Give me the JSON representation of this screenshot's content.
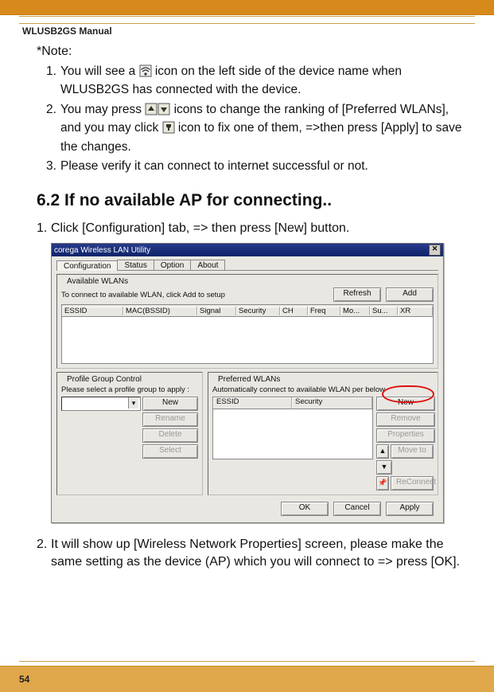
{
  "manual_title": "WLUSB2GS Manual",
  "note_label": "*Note:",
  "notes": {
    "item1": {
      "num": "1.",
      "pre": "You will see a ",
      "post": " icon on the left side of the device name when WLUSB2GS has connected  with the device."
    },
    "item2": {
      "num": "2.",
      "pre": "You may press  ",
      "mid1": "  icons to change the ranking of [Preferred WLANs], and you may click  ",
      "post": " icon to fix one of them, =>then press [Apply] to save the changes."
    },
    "item3": {
      "num": "3.",
      "text": "Please verify it can connect to internet successful or not."
    }
  },
  "section_heading": "6.2 If no available AP for connecting..",
  "step1": {
    "num": "1.",
    "text": "Click [Configuration] tab, => then press [New] button."
  },
  "step2": {
    "num": "2.",
    "text": "It will show up [Wireless Network Properties] screen, please make the same setting as the device (AP) which you will connect to => press [OK]."
  },
  "dialog": {
    "title": "corega Wireless LAN Utility",
    "tabs": {
      "configuration": "Configuration",
      "status": "Status",
      "option": "Option",
      "about": "About"
    },
    "available": {
      "title": "Available WLANs",
      "sub": "To connect to available WLAN, click Add to setup",
      "refresh": "Refresh",
      "add": "Add",
      "cols": {
        "essid": "ESSID",
        "mac": "MAC(BSSID)",
        "signal": "Signal",
        "security": "Security",
        "ch": "CH",
        "freq": "Freq",
        "mo": "Mo...",
        "su": "Su...",
        "xr": "XR"
      }
    },
    "profile": {
      "title": "Profile Group Control",
      "sub": "Please select a profile group to apply :",
      "new": "New",
      "rename": "Rename",
      "delete": "Delete",
      "select": "Select"
    },
    "preferred": {
      "title": "Preferred  WLANs",
      "sub": "Automatically connect to available WLAN per below",
      "cols": {
        "essid": "ESSID",
        "security": "Security"
      },
      "new": "New",
      "remove": "Remove",
      "properties": "Properties",
      "moveto": "Move to",
      "reconnect": "ReConnect"
    },
    "bottom": {
      "ok": "OK",
      "cancel": "Cancel",
      "apply": "Apply"
    }
  },
  "page_number": "54"
}
